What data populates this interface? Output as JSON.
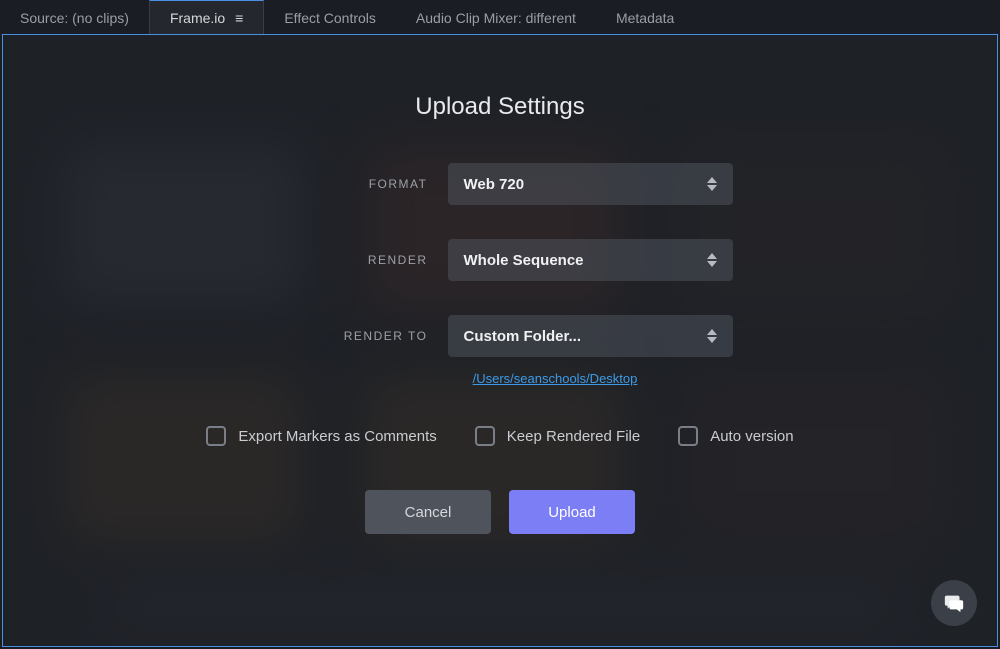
{
  "tabs": {
    "source": "Source: (no clips)",
    "frameio": "Frame.io",
    "effect_controls": "Effect Controls",
    "audio_mixer": "Audio Clip Mixer: different",
    "metadata": "Metadata"
  },
  "modal": {
    "title": "Upload Settings",
    "fields": {
      "format": {
        "label": "FORMAT",
        "value": "Web 720"
      },
      "render": {
        "label": "RENDER",
        "value": "Whole Sequence"
      },
      "render_to": {
        "label": "RENDER TO",
        "value": "Custom Folder..."
      }
    },
    "path": "/Users/seanschools/Desktop",
    "checkboxes": {
      "export_markers": "Export Markers as Comments",
      "keep_rendered": "Keep Rendered File",
      "auto_version": "Auto version"
    },
    "buttons": {
      "cancel": "Cancel",
      "upload": "Upload"
    }
  },
  "colors": {
    "accent": "#7b7ef5",
    "link": "#3b9be8",
    "tab_active_border": "#4a90e2"
  }
}
